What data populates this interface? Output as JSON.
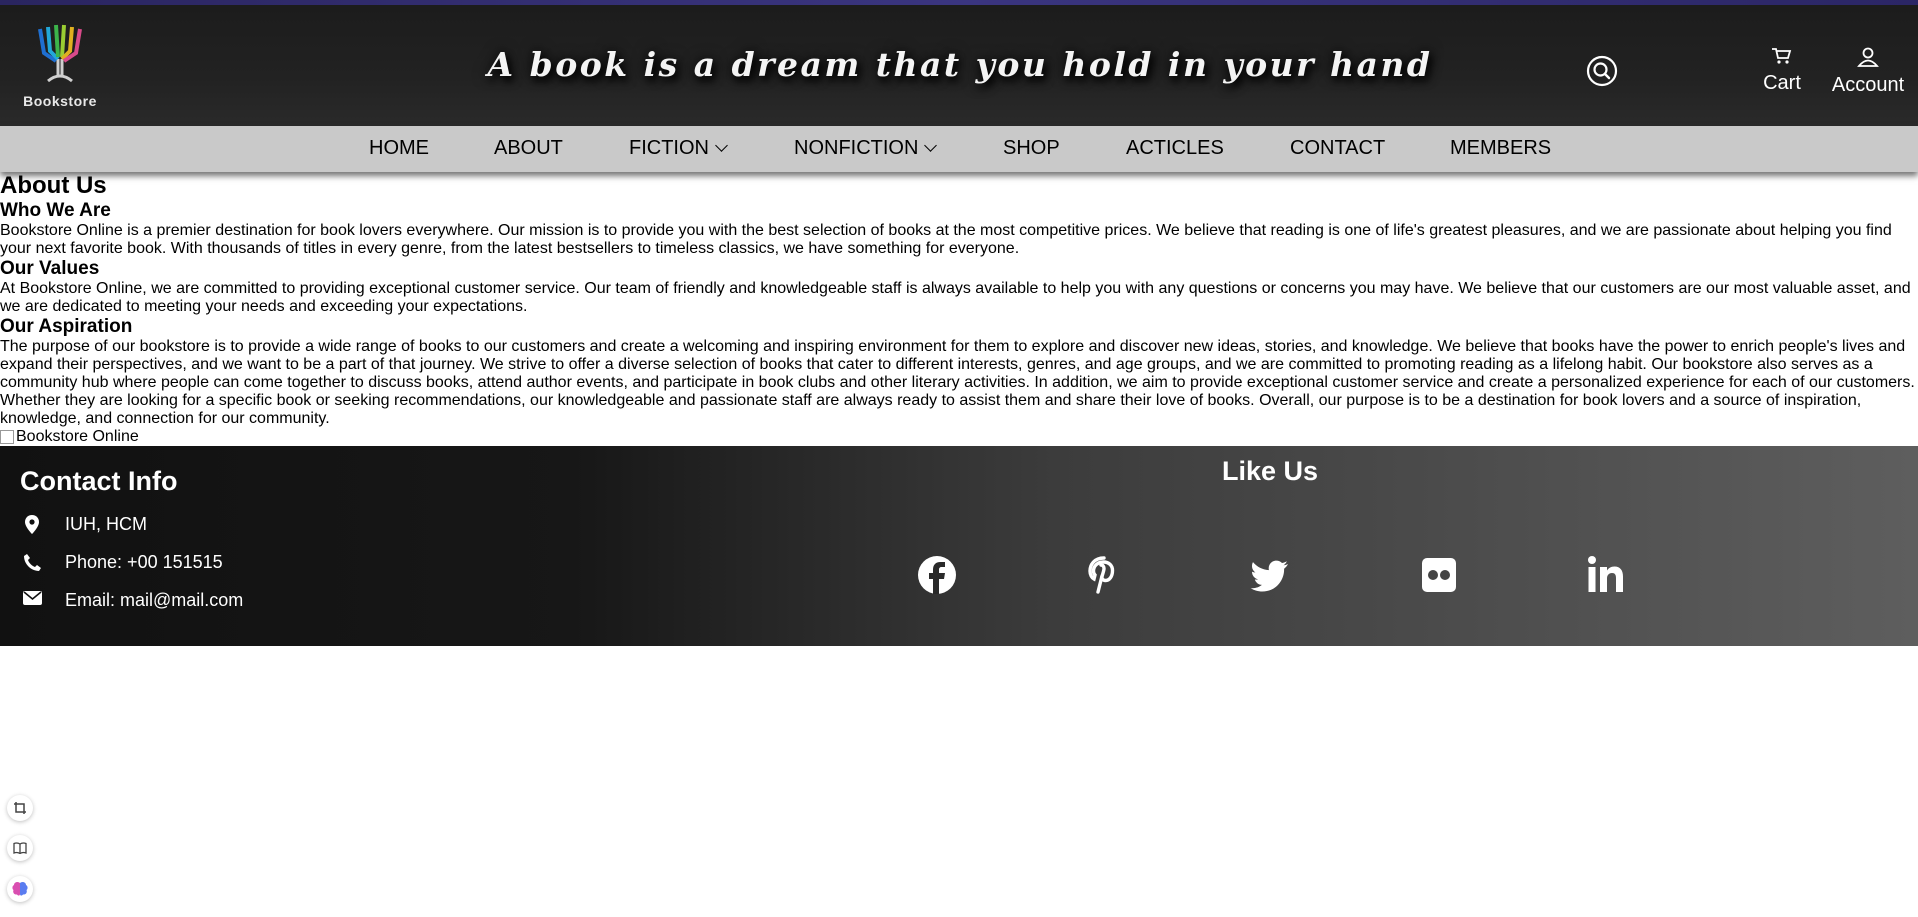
{
  "header": {
    "brand": "Bookstore",
    "tagline": "A book is a dream that you hold in your hand",
    "cart_label": "Cart",
    "account_label": "Account"
  },
  "nav": {
    "items": [
      {
        "label": "HOME"
      },
      {
        "label": "ABOUT"
      },
      {
        "label": "FICTION"
      },
      {
        "label": "NONFICTION"
      },
      {
        "label": "SHOP"
      },
      {
        "label": "ACTICLES"
      },
      {
        "label": "CONTACT"
      },
      {
        "label": "MEMBERS"
      }
    ]
  },
  "about": {
    "title": "About Us",
    "sections": [
      {
        "heading": "Who We Are",
        "body": "Bookstore Online is a premier destination for book lovers everywhere. Our mission is to provide you with the best selection of books at the most competitive prices. We believe that reading is one of life's greatest pleasures, and we are passionate about helping you find your next favorite book. With thousands of titles in every genre, from the latest bestsellers to timeless classics, we have something for everyone."
      },
      {
        "heading": "Our Values",
        "body": "At Bookstore Online, we are committed to providing exceptional customer service. Our team of friendly and knowledgeable staff is always available to help you with any questions or concerns you may have. We believe that our customers are our most valuable asset, and we are dedicated to meeting your needs and exceeding your expectations."
      },
      {
        "heading": "Our Aspiration",
        "body": "The purpose of our bookstore is to provide a wide range of books to our customers and create a welcoming and inspiring environment for them to explore and discover new ideas, stories, and knowledge. We believe that books have the power to enrich people's lives and expand their perspectives, and we want to be a part of that journey. We strive to offer a diverse selection of books that cater to different interests, genres, and age groups, and we are committed to promoting reading as a lifelong habit. Our bookstore also serves as a community hub where people can come together to discuss books, attend author events, and participate in book clubs and other literary activities. In addition, we aim to provide exceptional customer service and create a personalized experience for each of our customers. Whether they are looking for a specific book or seeking recommendations, our knowledgeable and passionate staff are always ready to assist them and share their love of books. Overall, our purpose is to be a destination for book lovers and a source of inspiration, knowledge, and connection for our community."
      }
    ],
    "image_alt": "Bookstore Online"
  },
  "footer": {
    "contact_title": "Contact Info",
    "address": "IUH, HCM",
    "phone": "Phone: +00 151515",
    "email": "Email: mail@mail.com",
    "like_title": "Like Us",
    "socials": [
      "facebook-icon",
      "pinterest-icon",
      "twitter-icon",
      "flickr-icon",
      "linkedin-icon"
    ]
  },
  "side_tools": [
    "crop-icon",
    "book-icon",
    "brain-icon"
  ],
  "colors": {
    "nav_bg": "#c9c9c9",
    "header_bg": "#1c1c1c",
    "top_strip": "#2a2560"
  }
}
